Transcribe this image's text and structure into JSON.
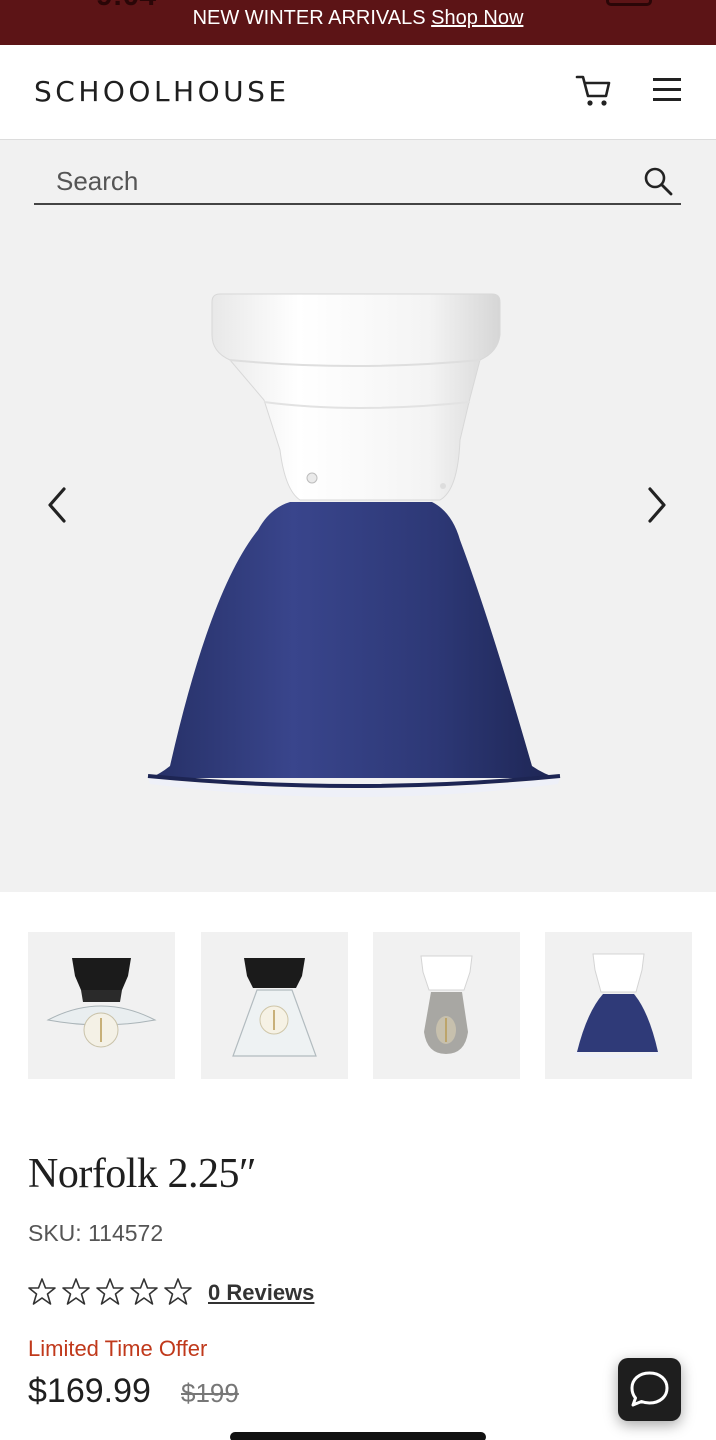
{
  "promo": {
    "text": "NEW WINTER ARRIVALS",
    "link": "Shop Now",
    "background": "#5c1416"
  },
  "header": {
    "logo": "SCHOOLHOUSE",
    "icons": [
      "cart-icon",
      "hamburger-menu-icon"
    ]
  },
  "search": {
    "placeholder": "Search",
    "icon": "search-icon"
  },
  "gallery": {
    "prev_icon": "chevron-left-icon",
    "next_icon": "chevron-right-icon",
    "hero_shade_color": "#2f3a78",
    "thumbnails": [
      {
        "name": "black-fitter-clear-flat-shade"
      },
      {
        "name": "black-fitter-clear-cone-shade"
      },
      {
        "name": "white-fitter-smoke-glass-shade"
      },
      {
        "name": "white-fitter-navy-dome-shade"
      }
    ]
  },
  "product": {
    "title": "Norfolk 2.25″",
    "sku_label": "SKU:",
    "sku_value": "114572",
    "rating": 0,
    "rating_max": 5,
    "reviews": "0 Reviews",
    "offer": "Limited Time Offer",
    "price": "$169.99",
    "old_price": "$199",
    "offer_color": "#c0391b"
  },
  "chat": {
    "icon": "chat-bubble-icon"
  }
}
